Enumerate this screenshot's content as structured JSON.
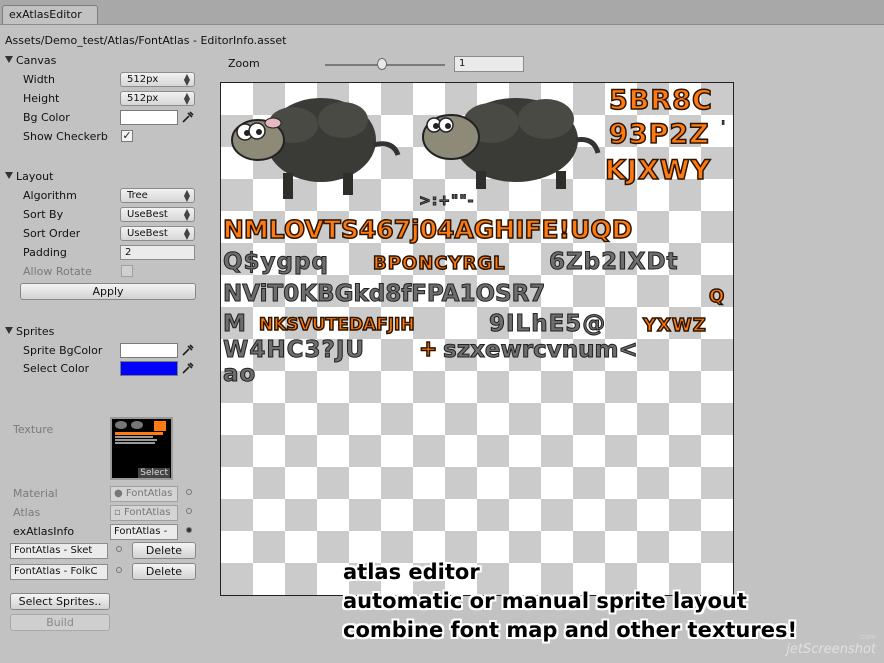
{
  "window": {
    "tab_label": "exAtlasEditor"
  },
  "asset_path": "Assets/Demo_test/Atlas/FontAtlas - EditorInfo.asset",
  "canvas_section": {
    "title": "Canvas",
    "width_label": "Width",
    "width_value": "512px",
    "height_label": "Height",
    "height_value": "512px",
    "bg_color_label": "Bg Color",
    "show_checkerboard_label": "Show Checkerb",
    "bg_color": "#ffffff"
  },
  "layout_section": {
    "title": "Layout",
    "algorithm_label": "Algorithm",
    "algorithm_value": "Tree",
    "sort_by_label": "Sort By",
    "sort_by_value": "UseBest",
    "sort_order_label": "Sort Order",
    "sort_order_value": "UseBest",
    "padding_label": "Padding",
    "padding_value": "2",
    "allow_rotate_label": "Allow Rotate",
    "apply_label": "Apply"
  },
  "sprites_section": {
    "title": "Sprites",
    "sprite_bg_color_label": "Sprite BgColor",
    "select_color_label": "Select Color",
    "sprite_bg_color": "#ffffff",
    "select_color": "#0000ff"
  },
  "assets_section": {
    "texture_label": "Texture",
    "thumb_select_label": "Select",
    "material_label": "Material",
    "material_value": "FontAtlas",
    "atlas_label": "Atlas",
    "atlas_value": "FontAtlas",
    "atlas_info_label": "exAtlasInfo",
    "atlas_info_value": "FontAtlas -",
    "source_items": [
      {
        "name": "FontAtlas - Sket",
        "delete_label": "Delete"
      },
      {
        "name": "FontAtlas - FolkC",
        "delete_label": "Delete"
      }
    ],
    "select_sprites_label": "Select Sprites..",
    "build_label": "Build"
  },
  "zoom": {
    "label": "Zoom",
    "value": "1",
    "slider_value": 1
  },
  "atlas_preview": {
    "orange_rows": [
      "5BR8C",
      "93P2Z",
      "KJXWY",
      "NMLOVTS467j04AGHIFE!UQD"
    ],
    "gray_rows": [
      "Q$ygpq",
      "BPONCYRGL",
      "6Zb2IXDt",
      "NViT0KBGkd8fFPA1OSR7",
      "Q",
      "M",
      "NKSVUTEDAFJIH",
      "9ILhE5@",
      "YXWZ",
      "W4HC3?JU",
      "+",
      "szxewrcvnum<",
      "ao"
    ],
    "punct_row": ">:+\"\"-",
    "apostrophe": "'"
  },
  "captions": [
    "atlas editor",
    "automatic or manual sprite layout",
    "combine font map and other textures!"
  ],
  "watermark": {
    "main": "jetScreenshot",
    "small": ".com"
  }
}
